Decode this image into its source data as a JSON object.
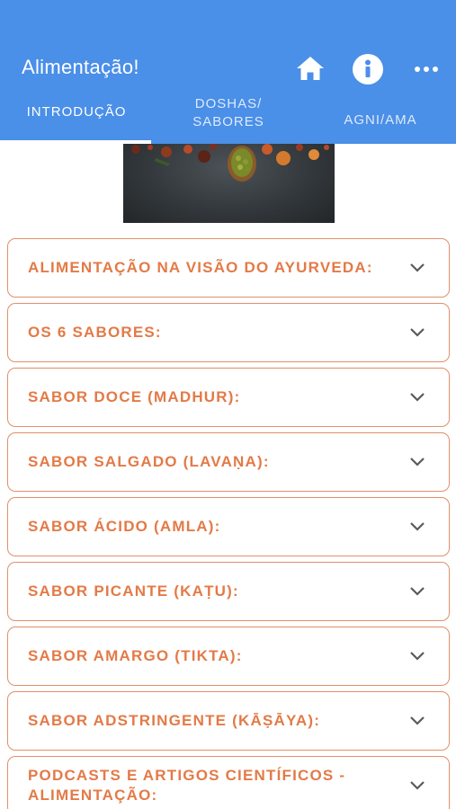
{
  "header": {
    "title": "Alimentação!",
    "background_color": "#4a8fe8",
    "actions": [
      {
        "icon": "home-icon"
      },
      {
        "icon": "info-icon"
      },
      {
        "icon": "more-horizontal-icon"
      }
    ]
  },
  "tabs": [
    {
      "label": "INTRODUÇÃO",
      "selected": true
    },
    {
      "label": "DOSHAS/ SABORES",
      "selected": false
    },
    {
      "label": "AGNI/AMA",
      "selected": false
    }
  ],
  "hero_image": {
    "subject": "spices-on-dark-slate"
  },
  "accordion": {
    "accent_color": "#e37a47",
    "items": [
      {
        "title": "ALIMENTAÇÃO NA VISÃO DO AYURVEDA:"
      },
      {
        "title": "OS 6 SABORES:"
      },
      {
        "title": "SABOR DOCE (MADHUR):"
      },
      {
        "title": "SABOR SALGADO (LAVAṆA):"
      },
      {
        "title": "SABOR ÁCIDO (AMLA):"
      },
      {
        "title": "SABOR PICANTE (KAṬU):"
      },
      {
        "title": "SABOR AMARGO (TIKTA):"
      },
      {
        "title": "SABOR ADSTRINGENTE (KĀṢĀYA):"
      },
      {
        "title": "PODCASTS E ARTIGOS CIENTÍFICOS - ALIMENTAÇÃO:"
      }
    ]
  }
}
